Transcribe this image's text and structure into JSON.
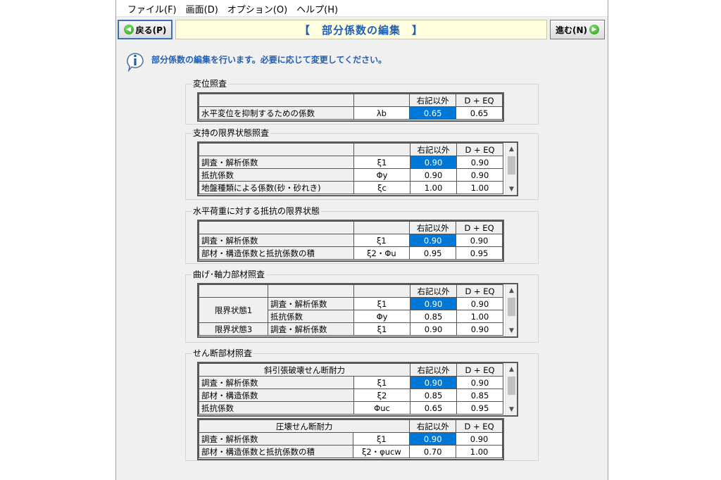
{
  "menu": [
    "ファイル(F)",
    "画面(D)",
    "オプション(O)",
    "ヘルプ(H)"
  ],
  "toolbar": {
    "back_label": "戻る(P)",
    "title": "【　部分係数の編集　】",
    "next_label": "進む(N)"
  },
  "info": {
    "message": "部分係数の編集を行います。必要に応じて変更してください。"
  },
  "headers": {
    "col1": "右記以外",
    "col2": "D + EQ"
  },
  "displacement": {
    "title": "変位照査",
    "rows": [
      {
        "label": "水平変位を抑制するための係数",
        "symbol": "λb",
        "v1": "0.65",
        "v2": "0.65"
      }
    ]
  },
  "bearing": {
    "title": "支持の限界状態照査",
    "rows": [
      {
        "label": "調査・解析係数",
        "symbol": "ξ1",
        "v1": "0.90",
        "v2": "0.90"
      },
      {
        "label": "抵抗係数",
        "symbol": "Φy",
        "v1": "0.90",
        "v2": "0.90"
      },
      {
        "label": "地盤種類による係数(砂・砂れき)",
        "symbol": "ξc",
        "v1": "1.00",
        "v2": "1.00"
      }
    ]
  },
  "horizontal": {
    "title": "水平荷重に対する抵抗の限界状態",
    "rows": [
      {
        "label": "調査・解析係数",
        "symbol": "ξ1",
        "v1": "0.90",
        "v2": "0.90"
      },
      {
        "label": "部材・構造係数と抵抗係数の積",
        "symbol": "ξ2・Φu",
        "v1": "0.95",
        "v2": "0.95"
      }
    ]
  },
  "bending": {
    "title": "曲げ･軸力部材照査",
    "group1": "限界状態1",
    "group3": "限界状態3",
    "rows": [
      {
        "label": "調査・解析係数",
        "symbol": "ξ1",
        "v1": "0.90",
        "v2": "0.90"
      },
      {
        "label": "抵抗係数",
        "symbol": "Φy",
        "v1": "0.85",
        "v2": "1.00"
      },
      {
        "label": "調査・解析係数",
        "symbol": "ξ1",
        "v1": "0.90",
        "v2": "0.90"
      }
    ]
  },
  "shear": {
    "title": "せん断部材照査",
    "diagonal": {
      "title": "斜引張破壊せん断耐力",
      "rows": [
        {
          "label": "調査・解析係数",
          "symbol": "ξ1",
          "v1": "0.90",
          "v2": "0.90"
        },
        {
          "label": "部材・構造係数",
          "symbol": "ξ2",
          "v1": "0.85",
          "v2": "0.85"
        },
        {
          "label": "抵抗係数",
          "symbol": "Φuc",
          "v1": "0.65",
          "v2": "0.95"
        }
      ]
    },
    "compression": {
      "title": "圧壊せん断耐力",
      "rows": [
        {
          "label": "調査・解析係数",
          "symbol": "ξ1",
          "v1": "0.90",
          "v2": "0.90"
        },
        {
          "label": "部材・構造係数と抵抗係数の積",
          "symbol": "ξ2・φucw",
          "v1": "0.70",
          "v2": "1.00"
        }
      ]
    }
  },
  "colors": {
    "accent": "#1f5fb8",
    "selection": "#0078d7",
    "title_bg": "#ffffe0",
    "go_arrow": "#2e9a22"
  },
  "icons": {
    "back": "back-arrow-icon",
    "next": "next-arrow-icon",
    "info": "info-icon",
    "scroll_up": "scroll-up-icon",
    "scroll_down": "scroll-down-icon"
  }
}
